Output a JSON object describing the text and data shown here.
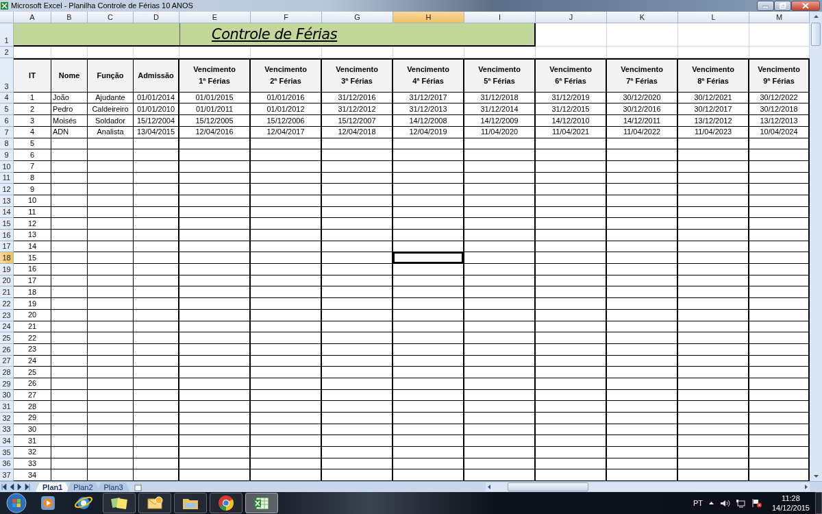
{
  "window": {
    "title": "Microsoft Excel - Planilha Controle de Férias 10 ANOS"
  },
  "column_headers": [
    {
      "label": "A",
      "selected": false
    },
    {
      "label": "B",
      "selected": false
    },
    {
      "label": "C",
      "selected": false
    },
    {
      "label": "D",
      "selected": false
    },
    {
      "label": "E",
      "selected": false
    },
    {
      "label": "F",
      "selected": false
    },
    {
      "label": "G",
      "selected": false
    },
    {
      "label": "H",
      "selected": true
    },
    {
      "label": "I",
      "selected": false
    },
    {
      "label": "J",
      "selected": false
    },
    {
      "label": "K",
      "selected": false
    },
    {
      "label": "L",
      "selected": false
    },
    {
      "label": "M",
      "selected": false
    }
  ],
  "row_headers": [
    {
      "label": "1",
      "selected": false
    },
    {
      "label": "2",
      "selected": false
    },
    {
      "label": "3",
      "selected": false
    },
    {
      "label": "4",
      "selected": false
    },
    {
      "label": "5",
      "selected": false
    },
    {
      "label": "6",
      "selected": false
    },
    {
      "label": "7",
      "selected": false
    },
    {
      "label": "8",
      "selected": false
    },
    {
      "label": "9",
      "selected": false
    },
    {
      "label": "10",
      "selected": false
    },
    {
      "label": "11",
      "selected": false
    },
    {
      "label": "12",
      "selected": false
    },
    {
      "label": "13",
      "selected": false
    },
    {
      "label": "14",
      "selected": false
    },
    {
      "label": "15",
      "selected": false
    },
    {
      "label": "16",
      "selected": false
    },
    {
      "label": "17",
      "selected": false
    },
    {
      "label": "18",
      "selected": true
    },
    {
      "label": "19",
      "selected": false
    },
    {
      "label": "20",
      "selected": false
    },
    {
      "label": "21",
      "selected": false
    },
    {
      "label": "22",
      "selected": false
    },
    {
      "label": "23",
      "selected": false
    },
    {
      "label": "24",
      "selected": false
    },
    {
      "label": "25",
      "selected": false
    },
    {
      "label": "26",
      "selected": false
    },
    {
      "label": "27",
      "selected": false
    },
    {
      "label": "28",
      "selected": false
    },
    {
      "label": "29",
      "selected": false
    },
    {
      "label": "30",
      "selected": false
    },
    {
      "label": "31",
      "selected": false
    },
    {
      "label": "32",
      "selected": false
    },
    {
      "label": "33",
      "selected": false
    },
    {
      "label": "34",
      "selected": false
    },
    {
      "label": "35",
      "selected": false
    },
    {
      "label": "36",
      "selected": false
    },
    {
      "label": "37",
      "selected": false
    }
  ],
  "title": "Controle de Férias",
  "table": {
    "columns": [
      "IT",
      "Nome",
      "Função",
      "Admissão",
      "Vencimento\n1ª Férias",
      "Vencimento\n2ª Férias",
      "Vencimento\n3ª Férias",
      "Vencimento\n4ª Férias",
      "Vencimento\n5ª Férias",
      "Vencimento\n6ª Férias",
      "Vencimento\n7ª Férias",
      "Vencimento\n8ª Férias",
      "Vencimento\n9ª Férias"
    ],
    "rows": [
      [
        "1",
        "João",
        "Ajudante",
        "01/01/2014",
        "01/01/2015",
        "01/01/2016",
        "31/12/2016",
        "31/12/2017",
        "31/12/2018",
        "31/12/2019",
        "30/12/2020",
        "30/12/2021",
        "30/12/2022"
      ],
      [
        "2",
        "Pedro",
        "Caldeireiro",
        "01/01/2010",
        "01/01/2011",
        "01/01/2012",
        "31/12/2012",
        "31/12/2013",
        "31/12/2014",
        "31/12/2015",
        "30/12/2016",
        "30/12/2017",
        "30/12/2018"
      ],
      [
        "3",
        "Moisés",
        "Soldador",
        "15/12/2004",
        "15/12/2005",
        "15/12/2006",
        "15/12/2007",
        "14/12/2008",
        "14/12/2009",
        "14/12/2010",
        "14/12/2011",
        "13/12/2012",
        "13/12/2013"
      ],
      [
        "4",
        "ADN",
        "Analista",
        "13/04/2015",
        "12/04/2016",
        "12/04/2017",
        "12/04/2018",
        "12/04/2019",
        "11/04/2020",
        "11/04/2021",
        "11/04/2022",
        "11/04/2023",
        "10/04/2024"
      ],
      [
        "5"
      ],
      [
        "6"
      ],
      [
        "7"
      ],
      [
        "8"
      ],
      [
        "9"
      ],
      [
        "10"
      ],
      [
        "11"
      ],
      [
        "12"
      ],
      [
        "13"
      ],
      [
        "14"
      ],
      [
        "15"
      ],
      [
        "16"
      ],
      [
        "17"
      ],
      [
        "18"
      ],
      [
        "19"
      ],
      [
        "20"
      ],
      [
        "21"
      ],
      [
        "22"
      ],
      [
        "23"
      ],
      [
        "24"
      ],
      [
        "25"
      ],
      [
        "26"
      ],
      [
        "27"
      ],
      [
        "28"
      ],
      [
        "29"
      ],
      [
        "30"
      ],
      [
        "31"
      ],
      [
        "32"
      ],
      [
        "33"
      ],
      [
        "34"
      ]
    ]
  },
  "sheet_tabs": [
    {
      "label": "Plan1",
      "selected": true
    },
    {
      "label": "Plan2",
      "selected": false
    },
    {
      "label": "Plan3",
      "selected": false
    }
  ],
  "taskbar": {
    "apps": [
      {
        "kind": "player",
        "running": false,
        "active": false
      },
      {
        "kind": "browser",
        "running": false,
        "active": false
      },
      {
        "kind": "notes",
        "running": true,
        "active": false
      },
      {
        "kind": "mail",
        "running": true,
        "active": false
      },
      {
        "kind": "folder",
        "running": true,
        "active": false
      },
      {
        "kind": "chrome",
        "running": true,
        "active": false
      },
      {
        "kind": "spreadsheet",
        "running": true,
        "active": true
      }
    ],
    "language": "PT",
    "time": "11:28",
    "date": "14/12/2015"
  }
}
